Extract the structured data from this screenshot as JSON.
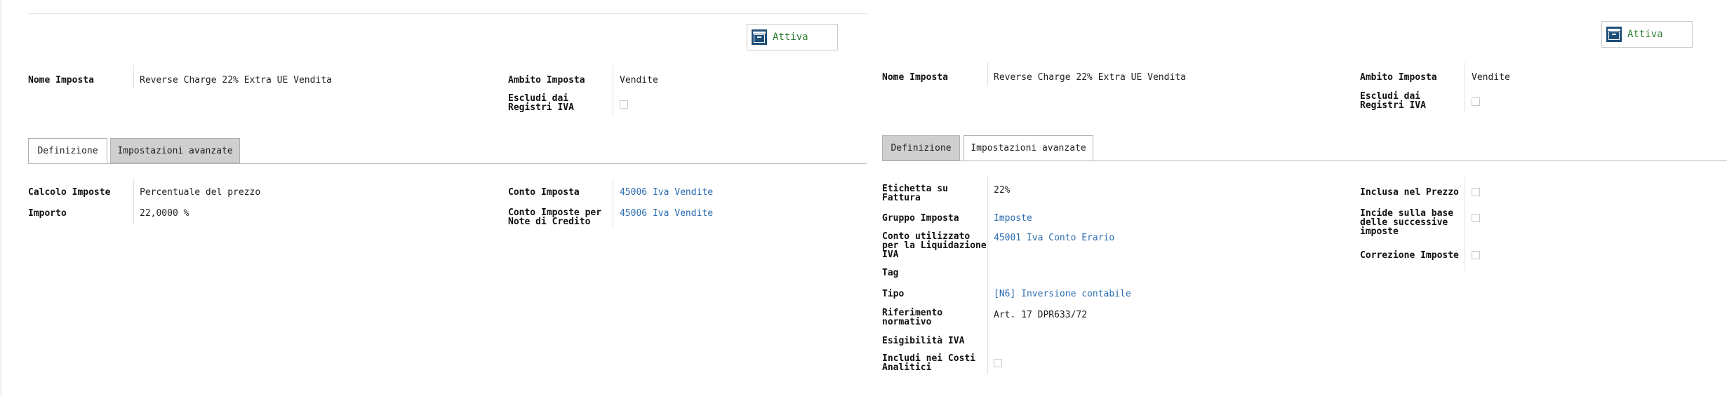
{
  "left_form": {
    "status_label": "Attiva",
    "nome_imposta_label": "Nome Imposta",
    "nome_imposta_value": "Reverse Charge 22% Extra UE Vendita",
    "ambito_label": "Ambito Imposta",
    "ambito_value": "Vendite",
    "escludi_label_1": "Escludi dai",
    "escludi_label_2": "Registri IVA",
    "tabs": [
      "Definizione",
      "Impostazioni avanzate"
    ],
    "calcolo_label": "Calcolo Imposte",
    "calcolo_value": "Percentuale del prezzo",
    "importo_label": "Importo",
    "importo_value": "22,0000 %",
    "conto_label": "Conto Imposta",
    "conto_value": "45006 Iva Vendite",
    "conto_nc_label_1": "Conto Imposte per",
    "conto_nc_label_2": "Note di Credito",
    "conto_nc_value": "45006 Iva Vendite"
  },
  "right_form": {
    "status_label": "Attiva",
    "nome_imposta_label": "Nome Imposta",
    "nome_imposta_value": "Reverse Charge 22% Extra UE Vendita",
    "ambito_label": "Ambito Imposta",
    "ambito_value": "Vendite",
    "escludi_label_1": "Escludi dai",
    "escludi_label_2": "Registri IVA",
    "tabs": [
      "Definizione",
      "Impostazioni avanzate"
    ],
    "etichetta_label_1": "Etichetta su",
    "etichetta_label_2": "Fattura",
    "etichetta_value": "22%",
    "gruppo_label": "Gruppo Imposta",
    "gruppo_value": "Imposte",
    "conto_liq_label_1": "Conto utilizzato",
    "conto_liq_label_2": "per la Liquidazione",
    "conto_liq_label_3": "IVA",
    "conto_liq_value": "45001 Iva Conto Erario",
    "tag_label": "Tag",
    "tipo_label": "Tipo",
    "tipo_value": "[N6] Inversione contabile",
    "riferimento_label_1": "Riferimento",
    "riferimento_label_2": "normativo",
    "riferimento_value": "Art. 17 DPR633/72",
    "esigibilita_label": "Esigibilità IVA",
    "includi_label_1": "Includi nei Costi",
    "includi_label_2": "Analitici",
    "inclusa_label": "Inclusa nel Prezzo",
    "incide_label_1": "Incide sulla base",
    "incide_label_2": "delle successive",
    "incide_label_3": "imposte",
    "correzione_label": "Correzione Imposte"
  },
  "colors": {
    "link": "#2b6cb0",
    "status_text": "#2e7d32",
    "archive_icon": "#1f4e79",
    "tab_inactive_bg": "#cfcfcf"
  },
  "icons": {
    "status": "archive-icon"
  }
}
